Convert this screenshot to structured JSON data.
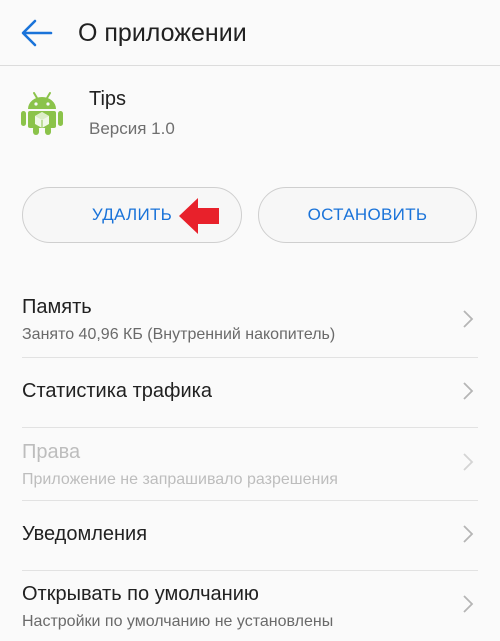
{
  "header": {
    "title": "О приложении",
    "back_icon": "back-arrow-icon"
  },
  "app": {
    "name": "Tips",
    "version": "Версия 1.0",
    "icon": "android-icon",
    "icon_color": "#8bc34a"
  },
  "buttons": {
    "uninstall": "УДАЛИТЬ",
    "stop": "ОСТАНОВИТЬ",
    "accent": "#1a73d9"
  },
  "annotation": {
    "arrow_icon": "red-arrow-icon",
    "color": "#e8212b"
  },
  "settings": [
    {
      "title": "Память",
      "subtitle": "Занято 40,96 КБ (Внутренний накопитель)",
      "enabled": true
    },
    {
      "title": "Статистика трафика",
      "subtitle": "",
      "enabled": true
    },
    {
      "title": "Права",
      "subtitle": "Приложение не запрашивало разрешения",
      "enabled": false
    },
    {
      "title": "Уведомления",
      "subtitle": "",
      "enabled": true
    },
    {
      "title": "Открывать по умолчанию",
      "subtitle": "Настройки по умолчанию не установлены",
      "enabled": true
    }
  ]
}
